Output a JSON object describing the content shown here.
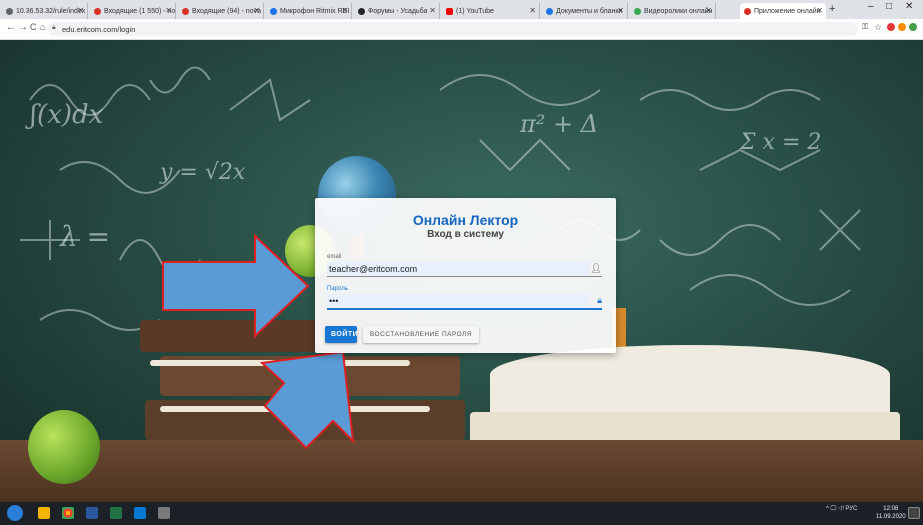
{
  "browser": {
    "tabs": [
      {
        "label": "10.36.53.32/rule/index",
        "color": "#5f6368"
      },
      {
        "label": "Входящие (1 550) - no",
        "color": "#d93025"
      },
      {
        "label": "Входящие (94) - nova",
        "color": "#d93025"
      },
      {
        "label": "Микрофон Ritmix RDI",
        "color": "#1a73e8"
      },
      {
        "label": "Форумы - Усадьба",
        "color": "#222222"
      },
      {
        "label": "(1) YouTube",
        "color": "#ff0000"
      },
      {
        "label": "Документы и бланки",
        "color": "#1a73e8"
      },
      {
        "label": "Видеоролики онлайн",
        "color": "#34a853"
      },
      {
        "label": "Приложение онлайн",
        "color": "#d93025",
        "active": true
      }
    ],
    "new_tab": "+",
    "window_controls": [
      "–",
      "□",
      "✕"
    ],
    "nav": [
      "←",
      "→",
      "C",
      "⌂"
    ],
    "url": "edu.eritcom.com/login"
  },
  "login": {
    "title": "Онлайн Лектор",
    "subtitle": "Вход в систему",
    "email_label": "email",
    "email_value": "teacher@eritcom.com",
    "password_label": "Пароль",
    "password_value": "•••",
    "login_button": "ВОЙТИ",
    "reset_button": "ВОССТАНОВЛЕНИЕ ПАРОЛЯ"
  },
  "taskbar": {
    "tray_text": "^ 🖵 ◁ᴵ РУС",
    "time": "12:08",
    "date": "11.09.2020"
  },
  "colors": {
    "accent": "#1976d2",
    "annotation_arrow_fill": "#5b9bd5",
    "annotation_arrow_border": "#e02020"
  }
}
